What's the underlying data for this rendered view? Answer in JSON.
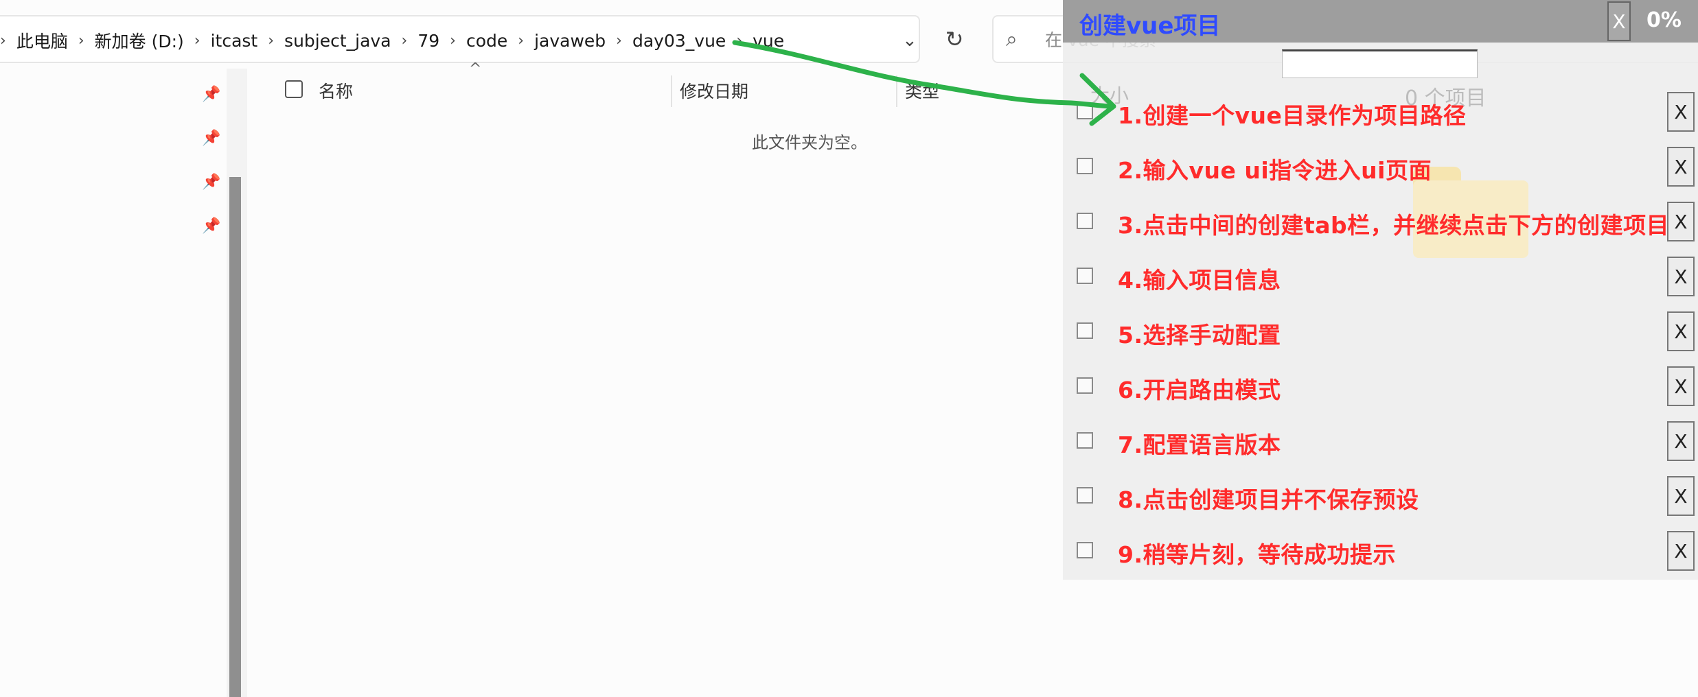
{
  "explorer": {
    "breadcrumbs": [
      "此电脑",
      "新加卷 (D:)",
      "itcast",
      "subject_java",
      "79",
      "code",
      "javaweb",
      "day03_vue",
      "vue"
    ],
    "search_placeholder": "在 vue 中搜索",
    "columns": {
      "name": "名称",
      "modified": "修改日期",
      "type": "类型"
    },
    "empty_message": "此文件夹为空。",
    "status": {
      "size": "大小",
      "items": "0 个项目"
    }
  },
  "overlay": {
    "title": "创建vue项目",
    "close_label": "X",
    "progress": "0%",
    "task_delete_label": "X",
    "tasks": [
      "1.创建一个vue目录作为项目路径",
      "2.输入vue ui指令进入ui页面",
      "3.点击中间的创建tab栏，并继续点击下方的创建项目",
      "4.输入项目信息",
      "5.选择手动配置",
      "6.开启路由模式",
      "7.配置语言版本",
      "8.点击创建项目并不保存预设",
      "9.稍等片刻，等待成功提示"
    ]
  },
  "colors": {
    "title_blue": "#2f4bff",
    "task_red": "#ff2b2b",
    "arrow_green": "#2db24a"
  },
  "icons": [
    "chevron-right-icon",
    "chevron-down-icon",
    "refresh-icon",
    "search-icon",
    "pin-icon",
    "sort-up-icon",
    "folder-icon"
  ]
}
